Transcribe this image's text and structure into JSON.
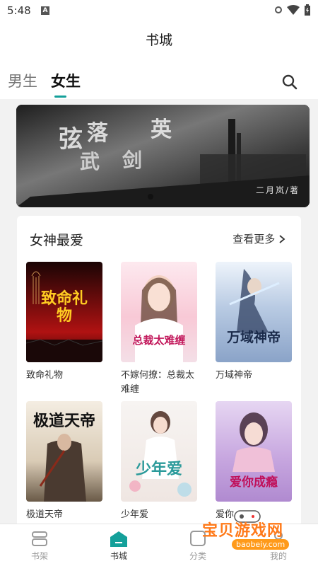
{
  "status_bar": {
    "time": "5:48",
    "notification_letter": "A"
  },
  "header": {
    "title": "书城"
  },
  "tabs": [
    {
      "label": "男生",
      "active": false
    },
    {
      "label": "女生",
      "active": true
    }
  ],
  "accent_color": "#14a09a",
  "banner": {
    "author_text": "二月岚/著",
    "icon": "carousel-dot"
  },
  "section": {
    "title": "女神最爱",
    "more_label": "查看更多",
    "books": [
      {
        "title": "致命礼物",
        "cover_text": "致命礼物"
      },
      {
        "title": "不嫁何撩：总裁太难缠",
        "cover_text": "总裁太难缠"
      },
      {
        "title": "万域神帝",
        "cover_text": "万域神帝"
      },
      {
        "title": "极道天帝",
        "cover_text": "极道天帝"
      },
      {
        "title": "少年爱",
        "cover_text": "少年爱"
      },
      {
        "title": "爱你",
        "cover_text": "爱你成瘾"
      }
    ]
  },
  "bottom_nav": [
    {
      "label": "书架",
      "icon": "bookshelf-icon",
      "active": false
    },
    {
      "label": "书城",
      "icon": "bookstore-icon",
      "active": true
    },
    {
      "label": "分类",
      "icon": "category-icon",
      "active": false
    },
    {
      "label": "我的",
      "icon": "profile-icon",
      "active": false
    }
  ],
  "watermark": {
    "text": "宝贝游戏网",
    "url": "baobeiy.com"
  }
}
